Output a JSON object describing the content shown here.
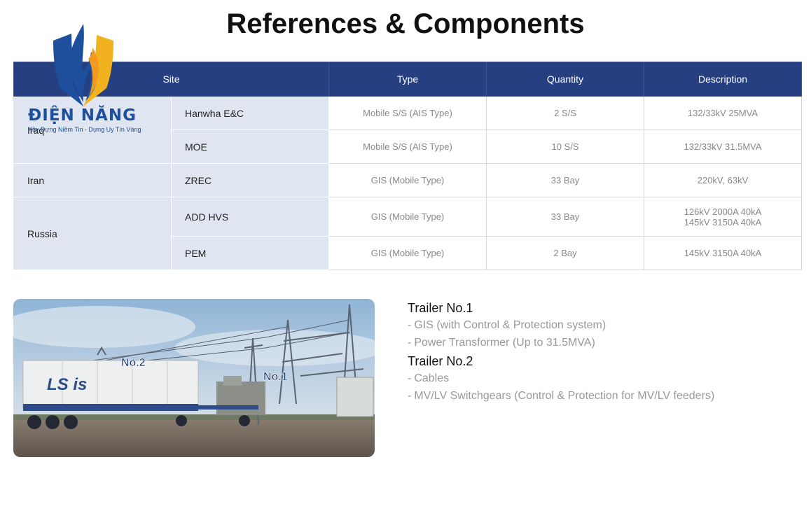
{
  "page": {
    "title": "References & Components"
  },
  "logo": {
    "name": "ĐIỆN NĂNG",
    "tagline": "Xây Dựng Niềm Tin - Dựng Uy Tín Vàng"
  },
  "table": {
    "headers": [
      "Site",
      "Type",
      "Quantity",
      "Description"
    ],
    "countries": [
      "Iraq",
      "Iran",
      "Russia"
    ],
    "rows": [
      {
        "sub": "Hanwha E&C",
        "type": "Mobile S/S (AIS Type)",
        "quantity": "2 S/S",
        "description": [
          "132/33kV 25MVA"
        ]
      },
      {
        "sub": "MOE",
        "type": "Mobile S/S (AIS Type)",
        "quantity": "10 S/S",
        "description": [
          "132/33kV 31.5MVA"
        ]
      },
      {
        "sub": "ZREC",
        "type": "GIS (Mobile Type)",
        "quantity": "33 Bay",
        "description": [
          "220kV, 63kV"
        ]
      },
      {
        "sub": "ADD HVS",
        "type": "GIS (Mobile Type)",
        "quantity": "33 Bay",
        "description": [
          "126kV 2000A 40kA",
          "145kV 3150A 40kA"
        ]
      },
      {
        "sub": "PEM",
        "type": "GIS (Mobile Type)",
        "quantity": "2 Bay",
        "description": [
          "145kV 3150A 40kA"
        ]
      }
    ]
  },
  "photo": {
    "label_no2": "No.2",
    "label_no1": "No.1",
    "brand": "LS is"
  },
  "trailers": [
    {
      "title": "Trailer No.1",
      "items": [
        "GIS (with Control & Protection system)",
        "Power Transformer (Up to 31.5MVA)"
      ]
    },
    {
      "title": "Trailer No.2",
      "items": [
        "Cables",
        "MV/LV Switchgears (Control & Protection for MV/LV feeders)"
      ]
    }
  ],
  "colors": {
    "header_bg": "#263f80",
    "site_bg": "#dfe6f1",
    "logo_blue": "#1d4f9c",
    "logo_orange": "#f29a1f"
  }
}
